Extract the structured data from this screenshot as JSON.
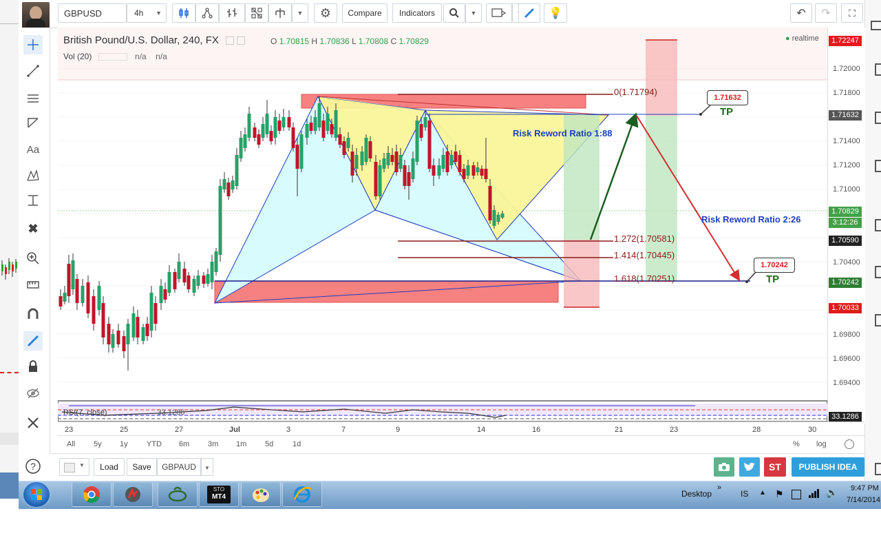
{
  "toolbar": {
    "symbol": "GBPUSD",
    "interval": "4h",
    "compare_label": "Compare",
    "indicators_label": "Indicators"
  },
  "chart": {
    "title": "British Pound/U.S. Dollar, 240, FX",
    "ohlc": {
      "o_label": "O",
      "o": "1.70815",
      "h_label": "H",
      "h": "1.70836",
      "l_label": "L",
      "l": "1.70808",
      "c_label": "C",
      "c": "1.70829"
    },
    "volume_label": "Vol (20)",
    "volume_values": [
      "n/a",
      "n/a"
    ],
    "realtime_label": "realtime",
    "price_axis": [
      "1.72000",
      "1.71800",
      "1.71400",
      "1.71200",
      "1.71000",
      "1.70400",
      "1.69800",
      "1.69600",
      "1.69400"
    ],
    "price_tags": [
      {
        "value": "1.72247",
        "color": "#e31a1c"
      },
      {
        "value": "1.71632",
        "color": "#555555"
      },
      {
        "value": "1.70829",
        "color": "#43a047"
      },
      {
        "value": "3:12:26",
        "color": "#43a047"
      },
      {
        "value": "1.70590",
        "color": "#222222"
      },
      {
        "value": "1.70242",
        "color": "#2e7d32"
      },
      {
        "value": "1.70033",
        "color": "#e31a1c"
      },
      {
        "value": "33.1286",
        "color": "#222222"
      }
    ],
    "fib_levels": [
      {
        "label": "0(1.71794)"
      },
      {
        "label": "1.272(1.70581)"
      },
      {
        "label": "1.414(1.70445)"
      },
      {
        "label": "1.618(1.70251)"
      }
    ],
    "annotations": {
      "rr1": "Risk Reword Ratio  1:88",
      "rr2": "Risk Reword Ratio  2:26",
      "tp1_value": "1.71632",
      "tp2_value": "1.70242",
      "tp_label": "TP"
    },
    "rsi_label": "RSI(7, close)",
    "rsi_value": "33.1286",
    "date_axis": [
      "23",
      "25",
      "27",
      "Jul",
      "3",
      "7",
      "9",
      "14",
      "16",
      "21",
      "23",
      "28",
      "30"
    ],
    "colors": {
      "up": "#26a269",
      "down": "#c0152a",
      "zone_red": "#f56b6b",
      "zone_yellow": "#f9f59a",
      "zone_cyan": "#d8fbfd",
      "link": "#1f3fbf",
      "tp_green": "#1b6b1b"
    }
  },
  "range_bar": {
    "buttons": [
      "All",
      "5y",
      "1y",
      "YTD",
      "6m",
      "3m",
      "1m",
      "5d",
      "1d"
    ],
    "right": [
      "%",
      "log"
    ]
  },
  "bottom_bar": {
    "load_label": "Load",
    "save_label": "Save",
    "layout_name": "GBPAUD",
    "st_label": "ST",
    "publish_label": "PUBLISH IDEA"
  },
  "taskbar": {
    "apps": [
      "Chrome",
      "FxPro",
      "Crescent",
      "MT4",
      "Paint",
      "Internet Explorer"
    ],
    "mt4_label": "MT4",
    "mt4_top": "STO",
    "desktop_label": "Desktop",
    "lang": "IS",
    "time": "9:47 PM",
    "date": "7/14/2014"
  }
}
